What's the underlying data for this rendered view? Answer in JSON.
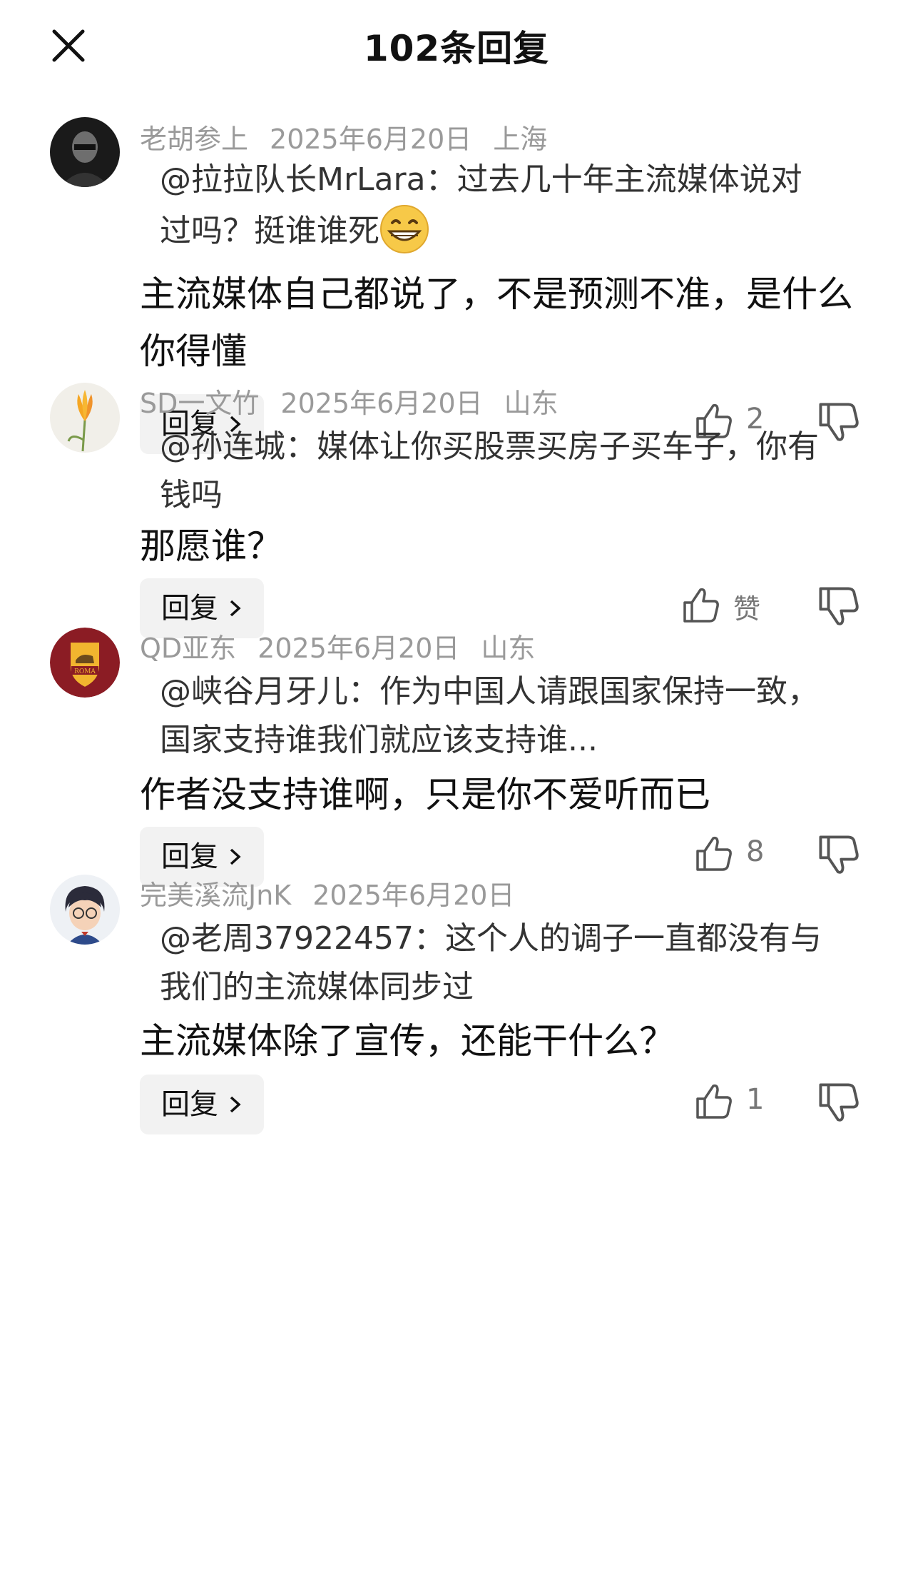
{
  "header": {
    "title": "102条回复"
  },
  "comments": [
    {
      "user": "老胡参上",
      "date": "2025年6月20日",
      "location": "上海",
      "quote": "@拉拉队长MrLara：过去几十年主流媒体说对过吗？挺谁谁死",
      "text": "主流媒体自己都说了，不是预测不准，是什么你得懂",
      "reply_label": "回复",
      "likes": "2"
    },
    {
      "user": "SD一文竹",
      "date": "2025年6月20日",
      "location": "山东",
      "quote": "@孙连城：媒体让你买股票买房子买车子，你有钱吗",
      "text": "那愿谁？",
      "reply_label": "回复",
      "likes": "赞"
    },
    {
      "user": "QD亚东",
      "date": "2025年6月20日",
      "location": "山东",
      "quote": "@峡谷月牙儿：作为中国人请跟国家保持一致，国家支持谁我们就应该支持谁...",
      "text": "作者没支持谁啊，只是你不爱听而已",
      "reply_label": "回复",
      "likes": "8",
      "avatar_text": "ROMA"
    },
    {
      "user": "完美溪流JnK",
      "date": "2025年6月20日",
      "location": "",
      "quote": "@老周37922457：这个人的调子一直都没有与我们的主流媒体同步过",
      "text": "主流媒体除了宣传，还能干什么？",
      "reply_label": "回复",
      "likes": "1"
    }
  ]
}
